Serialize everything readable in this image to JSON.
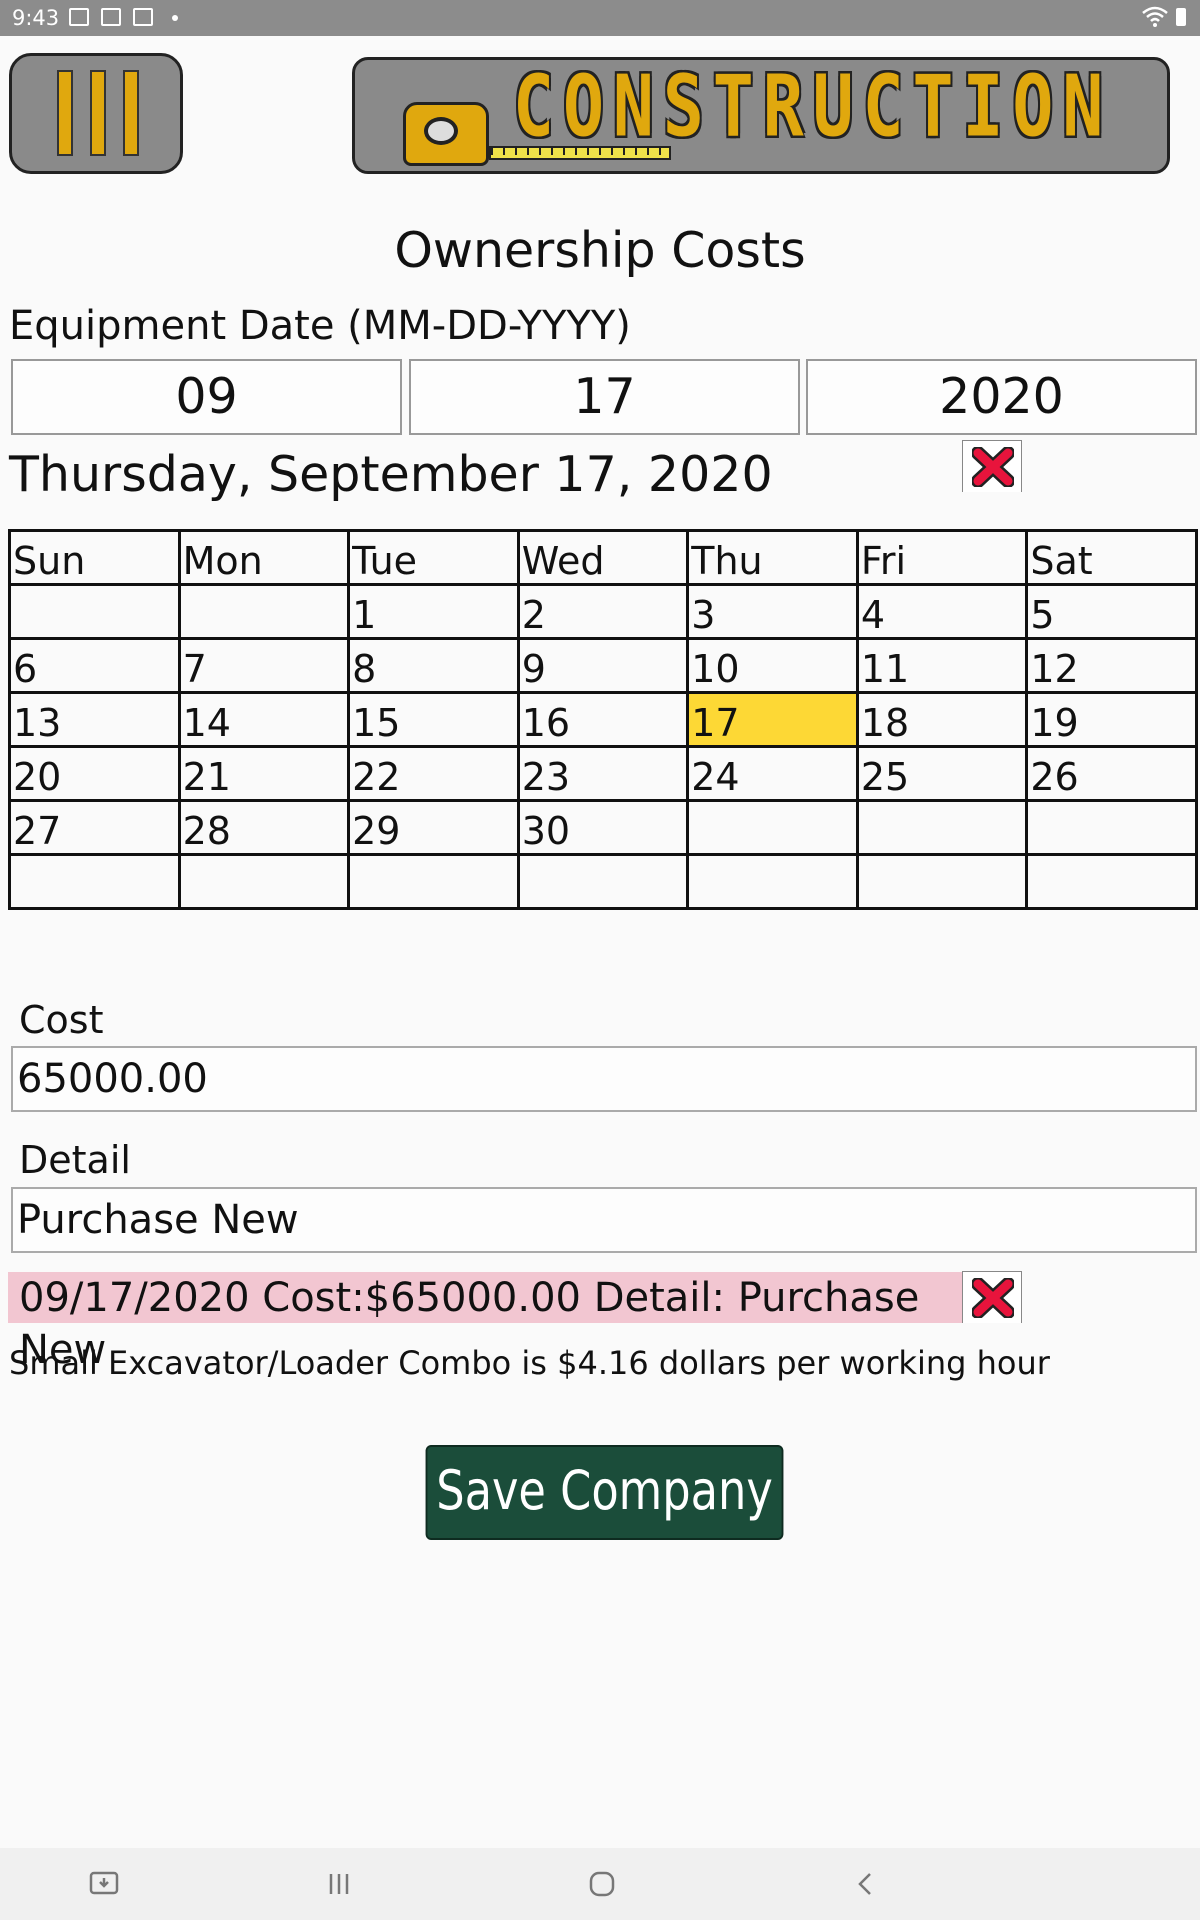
{
  "status_bar": {
    "time": "9:43"
  },
  "banner": {
    "word": "CONSTRUCTION"
  },
  "page": {
    "title": "Ownership Costs",
    "date_label": "Equipment Date (MM-DD-YYYY)",
    "date_month": "09",
    "date_day": "17",
    "date_year": "2020",
    "long_date": "Thursday, September 17, 2020"
  },
  "calendar": {
    "weekdays": [
      "Sun",
      "Mon",
      "Tue",
      "Wed",
      "Thu",
      "Fri",
      "Sat"
    ],
    "weeks": [
      [
        "",
        "",
        "1",
        "2",
        "3",
        "4",
        "5"
      ],
      [
        "6",
        "7",
        "8",
        "9",
        "10",
        "11",
        "12"
      ],
      [
        "13",
        "14",
        "15",
        "16",
        "17",
        "18",
        "19"
      ],
      [
        "20",
        "21",
        "22",
        "23",
        "24",
        "25",
        "26"
      ],
      [
        "27",
        "28",
        "29",
        "30",
        "",
        "",
        ""
      ],
      [
        "",
        "",
        "",
        "",
        "",
        "",
        ""
      ]
    ],
    "selected": "17"
  },
  "form": {
    "cost_label": "Cost",
    "cost_value": "65000.00",
    "detail_label": "Detail",
    "detail_value": "Purchase New"
  },
  "entry": {
    "text": "09/17/2020 Cost:$65000.00  Detail: Purchase New"
  },
  "summary": {
    "rate_text": "Small Excavator/Loader Combo is $4.16 dollars per working hour"
  },
  "actions": {
    "save_label": "Save Company"
  },
  "colors": {
    "accent": "#1b4d3a",
    "highlight": "#fdd835",
    "entry_bg": "#f2c6d1",
    "logo_yellow": "#e0a80e"
  },
  "icons": {
    "delete": "red-x-icon",
    "menu": "menu-icon"
  }
}
